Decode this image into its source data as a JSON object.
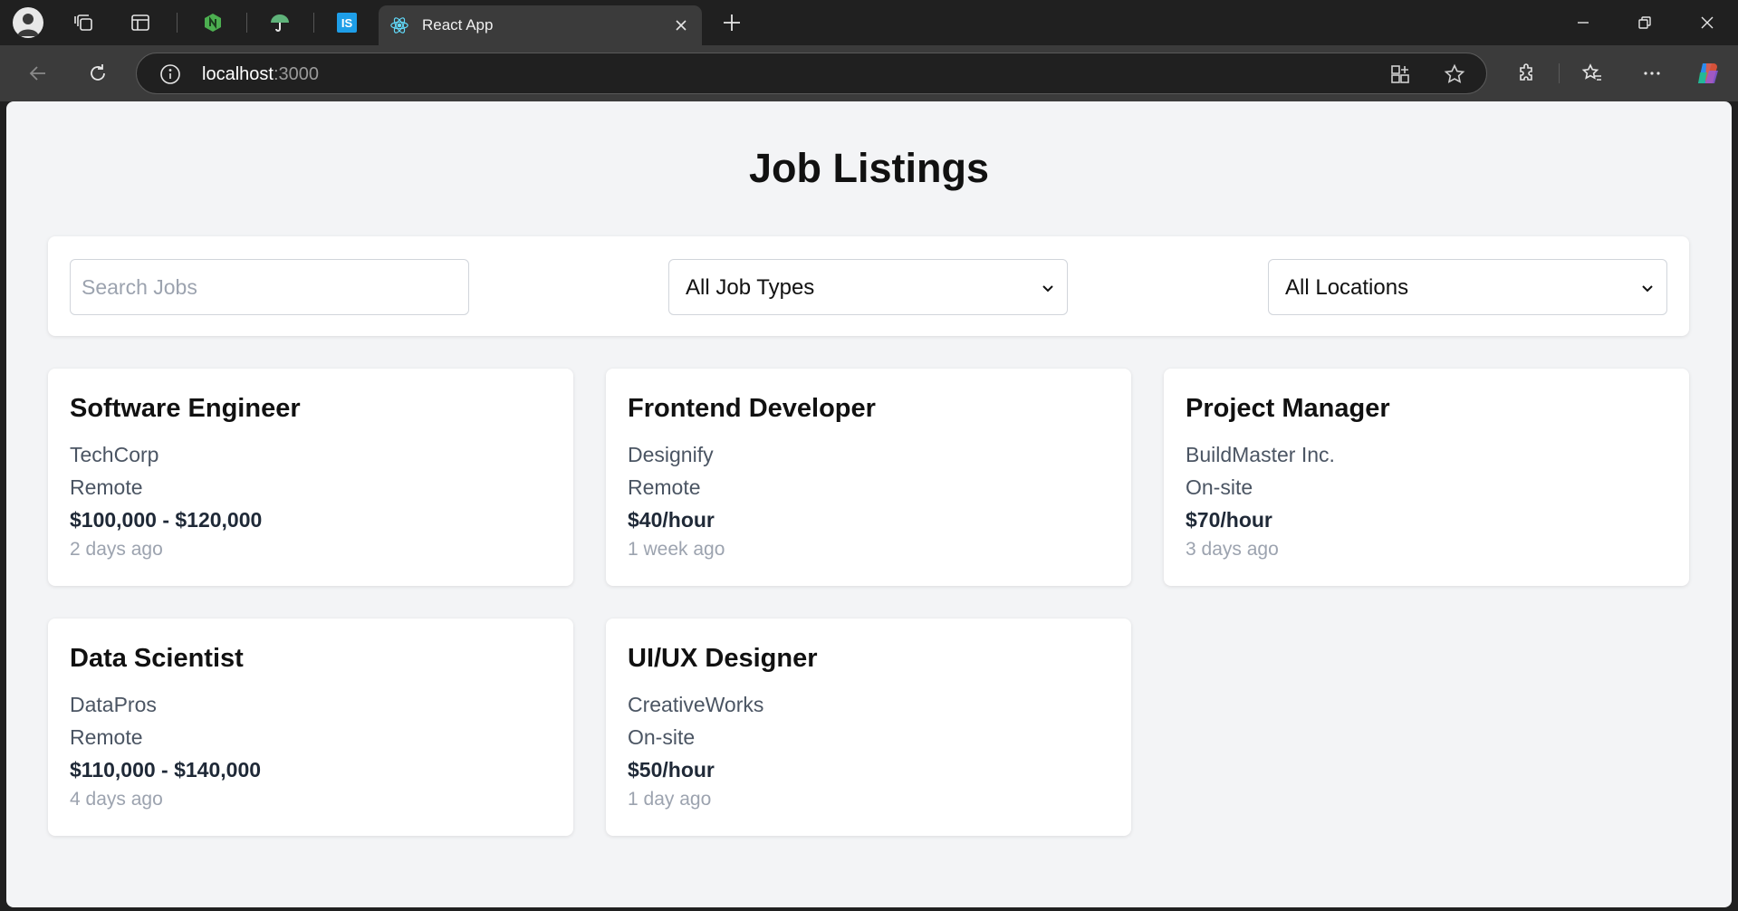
{
  "browser": {
    "tab_title": "React App",
    "url_host": "localhost",
    "url_port": ":3000"
  },
  "page": {
    "title": "Job Listings"
  },
  "filters": {
    "search_placeholder": "Search Jobs",
    "job_type_selected": "All Job Types",
    "location_selected": "All Locations"
  },
  "jobs": [
    {
      "title": "Software Engineer",
      "company": "TechCorp",
      "location": "Remote",
      "salary": "$100,000 - $120,000",
      "posted": "2 days ago"
    },
    {
      "title": "Frontend Developer",
      "company": "Designify",
      "location": "Remote",
      "salary": "$40/hour",
      "posted": "1 week ago"
    },
    {
      "title": "Project Manager",
      "company": "BuildMaster Inc.",
      "location": "On-site",
      "salary": "$70/hour",
      "posted": "3 days ago"
    },
    {
      "title": "Data Scientist",
      "company": "DataPros",
      "location": "Remote",
      "salary": "$110,000 - $140,000",
      "posted": "4 days ago"
    },
    {
      "title": "UI/UX Designer",
      "company": "CreativeWorks",
      "location": "On-site",
      "salary": "$50/hour",
      "posted": "1 day ago"
    }
  ]
}
